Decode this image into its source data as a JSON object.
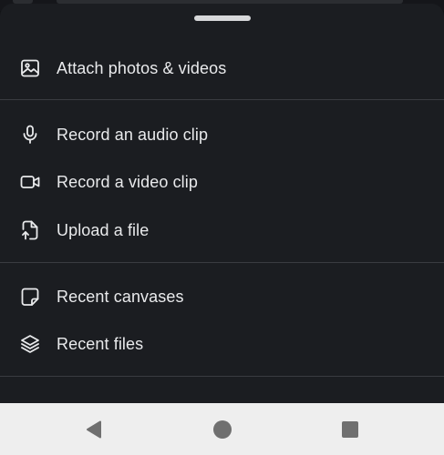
{
  "sheet": {
    "items": [
      {
        "label": "Attach photos & videos",
        "icon": "image-icon"
      },
      {
        "label": "Record an audio clip",
        "icon": "microphone-icon"
      },
      {
        "label": "Record a video clip",
        "icon": "video-camera-icon"
      },
      {
        "label": "Upload a file",
        "icon": "file-upload-icon"
      },
      {
        "label": "Recent canvases",
        "icon": "canvas-icon"
      },
      {
        "label": "Recent files",
        "icon": "layers-icon"
      }
    ]
  },
  "navbar": {
    "buttons": [
      "back-icon",
      "home-icon",
      "recents-icon"
    ]
  },
  "colors": {
    "sheet_bg": "#1b1d21",
    "text": "#e9eaec",
    "divider": "#3a3c41",
    "navbar_bg": "#eeeeee",
    "nav_icon": "#6f6f6f"
  }
}
